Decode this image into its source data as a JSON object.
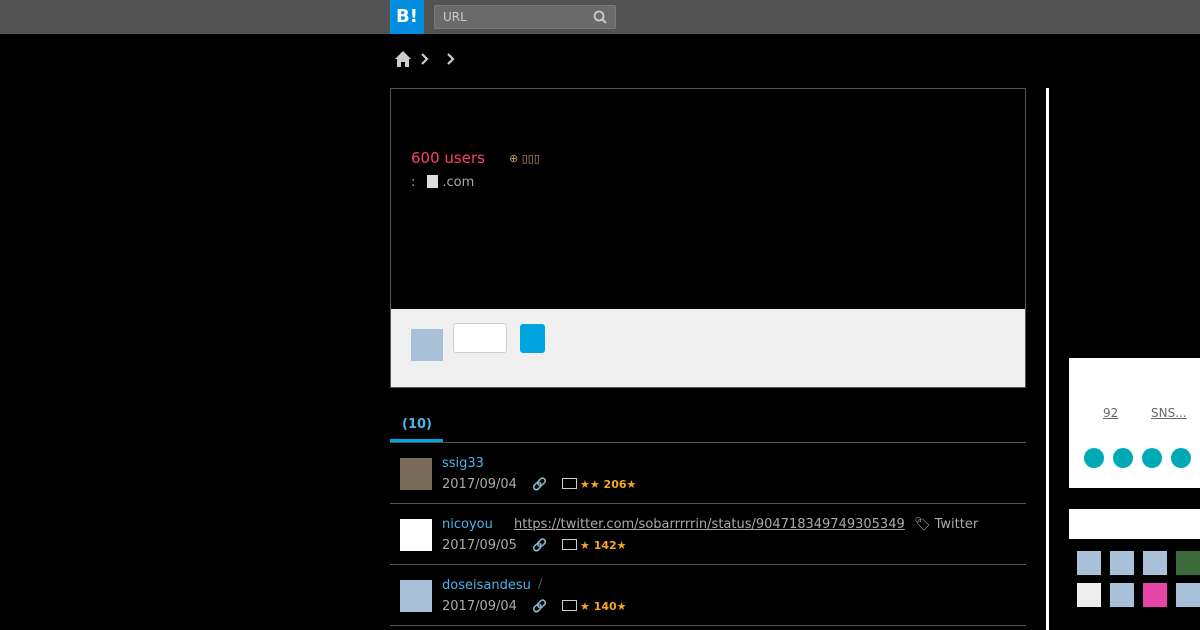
{
  "header": {
    "logo": "B!",
    "search_placeholder": "URL"
  },
  "entry": {
    "users": "600 users",
    "icons": "⊕ ▯▯▯",
    "domain_prefix": ":",
    "domain": ".com"
  },
  "tab": {
    "label": "(10)"
  },
  "bookmarks": [
    {
      "user": "ssig33",
      "date": "2017/09/04",
      "comment": "",
      "tag": "",
      "stars": "★★ 206★"
    },
    {
      "user": "nicoyou",
      "date": "2017/09/05",
      "comment": "https://twitter.com/sobarrrrrin/status/904718349749305349",
      "tag": "Twitter",
      "stars": "★ 142★"
    },
    {
      "user": "doseisandesu",
      "date": "2017/09/04",
      "comment": "",
      "tag": "",
      "stars": "★ 140★",
      "slash": "/"
    }
  ],
  "sidebar": {
    "count": "92",
    "sns": "SNS..."
  },
  "colors": {
    "accent": "#00a4de",
    "users": "#ff4166",
    "share": "#00a9b5"
  }
}
